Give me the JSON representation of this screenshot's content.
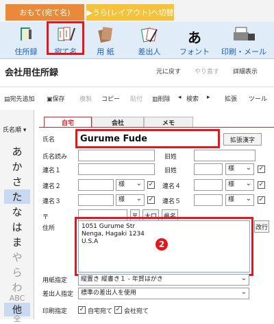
{
  "top_tabs": {
    "front": "おもて(宛て名)",
    "back": "▶うら(レイアウト)へ切替"
  },
  "ribbon": [
    {
      "label": "住所録",
      "icon": "address-book-icon"
    },
    {
      "label": "宛て名",
      "icon": "address-label-icon"
    },
    {
      "label": "用 紙",
      "icon": "paper-icon"
    },
    {
      "label": "差出人",
      "icon": "sender-icon"
    },
    {
      "label": "フォント",
      "icon": "font-icon"
    },
    {
      "label": "印刷・メール",
      "icon": "printer-icon"
    }
  ],
  "badges": {
    "one": "1",
    "two": "2"
  },
  "titlebar": {
    "title": "会社用住所録",
    "undo": "元に戻す",
    "redo": "やり直す",
    "detail": "詳細表示"
  },
  "toolbar": {
    "add": "宛先追加",
    "save": "保存",
    "copy": "複製",
    "copy2": "コピー",
    "paste": "貼付",
    "delete": "削除",
    "search": "検索",
    "expand": "拡張",
    "tool": "ツール"
  },
  "left": {
    "sort_label": "氏名順",
    "kana": [
      "あ",
      "か",
      "さ",
      "た",
      "な",
      "は",
      "ま",
      "や",
      "ら",
      "わ",
      "ABC",
      "他",
      "全"
    ]
  },
  "form_tabs": [
    "自宅",
    "会社",
    "メモ"
  ],
  "form": {
    "name_label": "氏名",
    "name_value": "Gurume Fude",
    "kanji_button": "拡張漢字",
    "name_reading": "氏名読み",
    "old_surname": "旧姓",
    "joint1": "連名１",
    "joint2": "連名２",
    "joint3": "連名３",
    "joint4": "連名４",
    "joint5": "連名５",
    "sama": "様",
    "zip_label": "〒",
    "zip_mark": "〒",
    "oguchi": "大口",
    "zip_search": "〒",
    "ken": "県名",
    "address_label": "住所",
    "address_value": "1051 Gurume Str\nNenga, Hagaki 1234\nU.S.A",
    "newline_button": "改行",
    "paper_label": "用紙指定",
    "paper_value": "縦置き 縦書き１ - 年賀はがき",
    "sender_label": "差出人指定",
    "sender_value": "標準の差出人を使用",
    "print_label": "印刷指定",
    "print_home": "自宅宛て",
    "print_company": "会社宛て"
  },
  "colors": {
    "accent_red": "#e8151b",
    "ribbon_bg": "#e0ecf8",
    "front_tab": "#e98a3a",
    "back_tab": "#f5c23c"
  }
}
